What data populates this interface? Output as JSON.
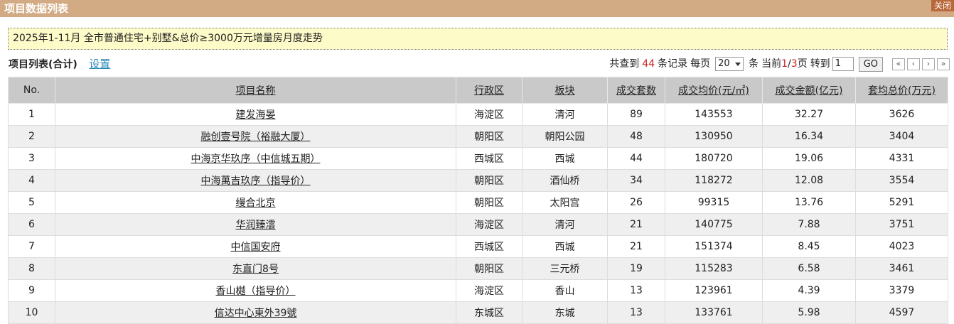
{
  "header": {
    "title": "项目数据列表",
    "close_label": "关闭"
  },
  "notice": {
    "text": "2025年1-11月 全市普通住宅+别墅&总价≥3000万元增量房月度走势"
  },
  "list": {
    "title": "项目列表(合计)",
    "settings_label": "设置"
  },
  "pager": {
    "prefix": "共查到",
    "total": "44",
    "records_label": "条记录",
    "per_page_label": "每页",
    "page_size": "20",
    "unit_label": "条",
    "current_label": "当前",
    "current_page": "1",
    "separator": "/",
    "total_pages": "3",
    "page_suffix": "页",
    "goto_label": "转到",
    "goto_value": "1",
    "go_label": "GO",
    "first_symbol": "«",
    "prev_symbol": "‹",
    "next_symbol": "›",
    "last_symbol": "»"
  },
  "table": {
    "columns": [
      "No.",
      "项目名称",
      "行政区",
      "板块",
      "成交套数",
      "成交均价(元/㎡)",
      "成交金额(亿元)",
      "套均总价(万元)"
    ],
    "rows": [
      [
        "1",
        "建发海晏",
        "海淀区",
        "清河",
        "89",
        "143553",
        "32.27",
        "3626"
      ],
      [
        "2",
        "融创壹号院（裕融大厦）",
        "朝阳区",
        "朝阳公园",
        "48",
        "130950",
        "16.34",
        "3404"
      ],
      [
        "3",
        "中海京华玖序（中信城五期）",
        "西城区",
        "西城",
        "44",
        "180720",
        "19.06",
        "4331"
      ],
      [
        "4",
        "中海萬吉玖序（指导价）",
        "朝阳区",
        "酒仙桥",
        "34",
        "118272",
        "12.08",
        "3554"
      ],
      [
        "5",
        "缦合北京",
        "朝阳区",
        "太阳宫",
        "26",
        "99315",
        "13.76",
        "5291"
      ],
      [
        "6",
        "华润臻澐",
        "海淀区",
        "清河",
        "21",
        "140775",
        "7.88",
        "3751"
      ],
      [
        "7",
        "中信国安府",
        "西城区",
        "西城",
        "21",
        "151374",
        "8.45",
        "4023"
      ],
      [
        "8",
        "东直门8号",
        "朝阳区",
        "三元桥",
        "19",
        "115283",
        "6.58",
        "3461"
      ],
      [
        "9",
        "香山樾（指导价）",
        "海淀区",
        "香山",
        "13",
        "123961",
        "4.39",
        "3379"
      ],
      [
        "10",
        "信达中心東外39號",
        "东城区",
        "东城",
        "13",
        "133761",
        "5.98",
        "4597"
      ]
    ]
  },
  "colors": {
    "title_bar": "#d2ab85",
    "close_button": "#b9683a",
    "notice_bg": "#fdfbc8",
    "header_bg": "#c9c9c9",
    "alt_row_bg": "#efefef",
    "link": "#2b8ab8",
    "highlight": "#cc2222"
  }
}
